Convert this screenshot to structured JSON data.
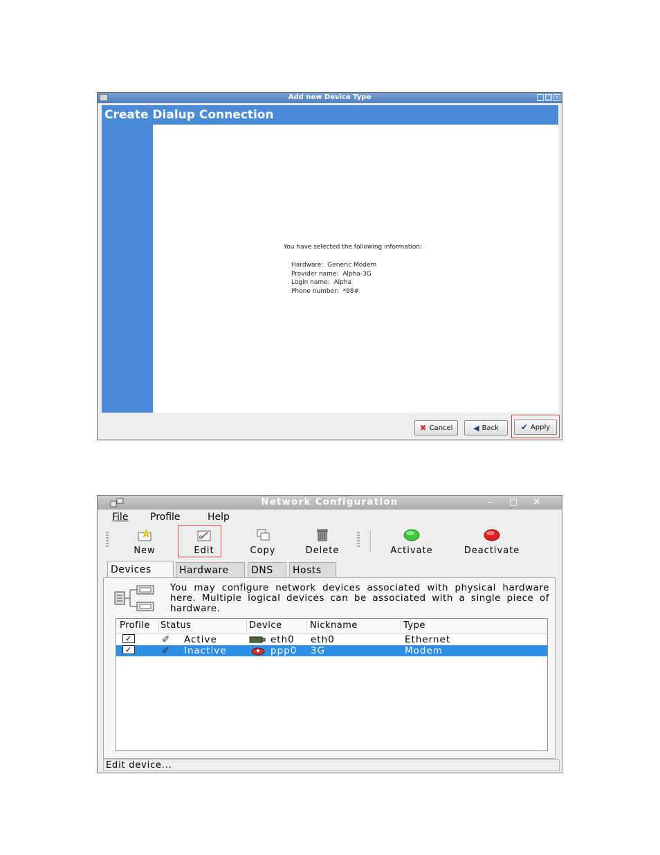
{
  "dialup": {
    "window_title": "Add new Device Type",
    "header": "Create Dialup Connection",
    "summary_text": "You have selected the following information:",
    "info": [
      {
        "label": "Hardware:",
        "value": "Generic Modem"
      },
      {
        "label": "Provider name:",
        "value": "Alpha-3G"
      },
      {
        "label": "Login name:",
        "value": "Alpha"
      },
      {
        "label": "Phone number:",
        "value": "*98#"
      }
    ],
    "buttons": {
      "cancel": "Cancel",
      "back": "Back",
      "apply": "Apply"
    },
    "colors": {
      "accent": "#4a8ad6",
      "highlight": "#d9434a"
    }
  },
  "netconf": {
    "window_title": "Network Configuration",
    "menu": [
      "File",
      "Profile",
      "Help"
    ],
    "toolbar": {
      "new": "New",
      "edit": "Edit",
      "copy": "Copy",
      "delete": "Delete",
      "activate": "Activate",
      "deactivate": "Deactivate"
    },
    "tabs": [
      "Devices",
      "Hardware",
      "DNS",
      "Hosts"
    ],
    "description": "You may configure network devices associated with physical hardware here. Multiple logical devices can be associated with a single piece of hardware.",
    "columns": [
      "Profile",
      "Status",
      "Device",
      "Nickname",
      "Type"
    ],
    "rows": [
      {
        "profile": "✓",
        "status": "Active",
        "device": "eth0",
        "nickname": "eth0",
        "type": "Ethernet",
        "selected": false
      },
      {
        "profile": "✓",
        "status": "Inactive",
        "device": "ppp0",
        "nickname": "3G",
        "type": "Modem",
        "selected": true
      }
    ],
    "statusbar": "Edit device...",
    "colors": {
      "selection": "#2e8fe6",
      "activate": "#3cc43c",
      "deactivate": "#e02020"
    }
  }
}
